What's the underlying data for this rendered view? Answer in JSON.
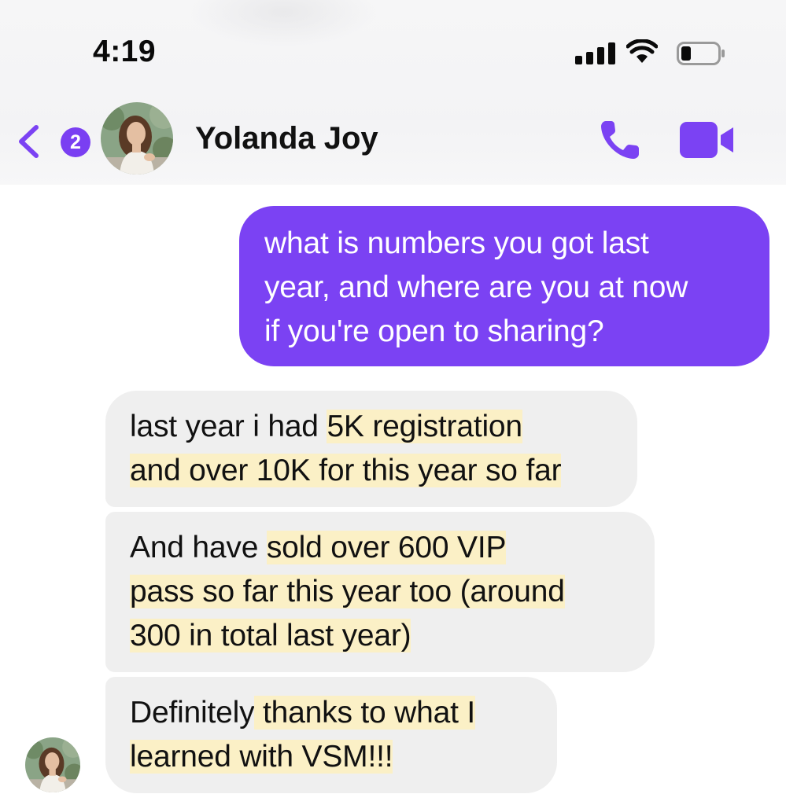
{
  "status_bar": {
    "time": "4:19"
  },
  "header": {
    "back_badge_count": "2",
    "contact_name": "Yolanda Joy",
    "accent_color": "#7b42f3"
  },
  "messages": {
    "outgoing_1": {
      "lines": [
        "what is numbers you got last",
        "year, and where are you at now",
        "if you're open to sharing?"
      ]
    },
    "incoming_1": {
      "line1_plain": "last year i had ",
      "line1_highlight": "5K registration",
      "line2_highlight": "and over 10K for this year so far"
    },
    "incoming_2": {
      "line1_plain": "And have ",
      "line1_highlight": "sold over 600 VIP",
      "line2_highlight": "pass so far this year too (around",
      "line3_highlight": "300 in total last year)"
    },
    "incoming_3": {
      "line1_plain": "Definitely",
      "line1_highlight": " thanks to what I",
      "line2_highlight": "learned with VSM!!!"
    }
  },
  "colors": {
    "outgoing_bubble": "#7b42f3",
    "incoming_bubble": "#efefef",
    "highlight": "#fbf0c6"
  },
  "icons": {
    "back": "chevron-left-icon",
    "phone": "phone-icon",
    "video": "video-camera-icon",
    "signal": "cellular-signal-icon",
    "wifi": "wifi-icon",
    "battery": "battery-icon"
  }
}
